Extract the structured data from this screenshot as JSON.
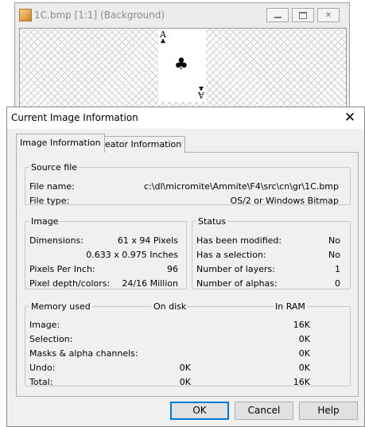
{
  "background_window": {
    "title": "1C.bmp [1:1] (Background)",
    "card": {
      "rank": "A",
      "suit": "♣"
    }
  },
  "dialog": {
    "title": "Current Image Information",
    "close_glyph": "✕",
    "tabs": [
      "Image Information",
      "Creator Information"
    ],
    "source_file": {
      "legend": "Source file",
      "file_name_label": "File name:",
      "file_name": "c:\\dl\\micromite\\Ammite\\F4\\src\\cn\\gr\\1C.bmp",
      "file_type_label": "File type:",
      "file_type": "OS/2 or Windows Bitmap"
    },
    "image": {
      "legend": "Image",
      "dimensions_label": "Dimensions:",
      "dimensions_pixels": "61 x 94 Pixels",
      "dimensions_inches": "0.633 x 0.975 Inches",
      "ppi_label": "Pixels Per Inch:",
      "ppi": "96",
      "depth_label": "Pixel depth/colors:",
      "depth": "24/16 Million"
    },
    "status": {
      "legend": "Status",
      "modified_label": "Has been modified:",
      "modified": "No",
      "selection_label": "Has a selection:",
      "selection": "No",
      "layers_label": "Number of layers:",
      "layers": "1",
      "alphas_label": "Number of alphas:",
      "alphas": "0"
    },
    "memory": {
      "legend": "Memory used",
      "col_disk": "On disk",
      "col_ram": "In RAM",
      "rows": [
        {
          "label": "Image:",
          "disk": "",
          "ram": "16K"
        },
        {
          "label": "Selection:",
          "disk": "",
          "ram": "0K"
        },
        {
          "label": "Masks & alpha channels:",
          "disk": "",
          "ram": "0K"
        },
        {
          "label": "Undo:",
          "disk": "0K",
          "ram": "0K"
        },
        {
          "label": "Total:",
          "disk": "0K",
          "ram": "16K"
        }
      ]
    },
    "buttons": {
      "ok": "OK",
      "cancel": "Cancel",
      "help": "Help"
    }
  }
}
